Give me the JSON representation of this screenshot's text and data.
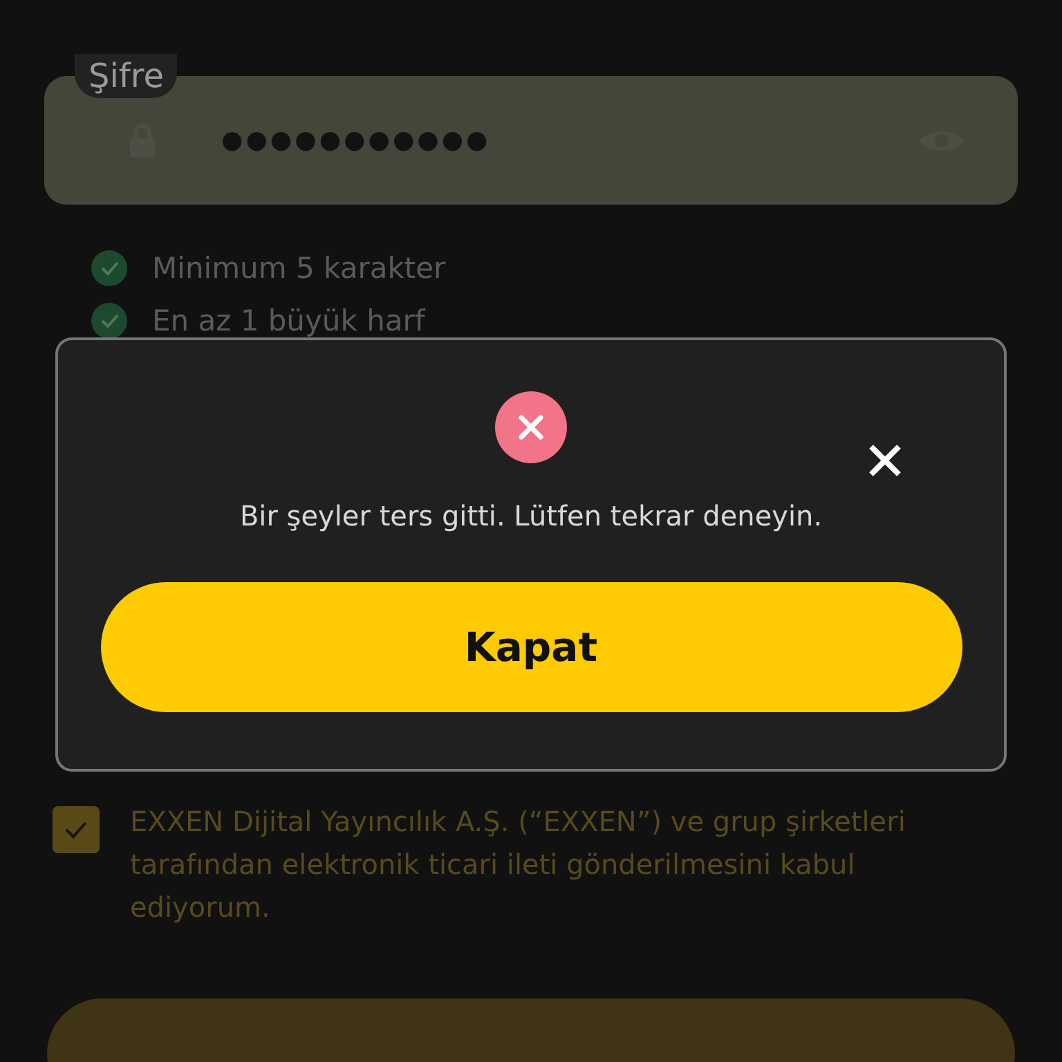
{
  "password_field": {
    "label": "Şifre",
    "value": "●●●●●●●●●●●"
  },
  "rules": [
    {
      "text": "Minimum 5 karakter",
      "met": true
    },
    {
      "text": "En az 1 büyük harf",
      "met": true
    }
  ],
  "consent": {
    "text": "EXXEN Dijital Yayıncılık A.Ş. (“EXXEN”) ve grup şirketleri tarafından elektronik ticari ileti gönderilmesini kabul ediyorum.",
    "checked": true
  },
  "dialog": {
    "kind": "error",
    "message": "Bir şeyler ters gitti. Lütfen tekrar deneyin.",
    "button": "Kapat"
  }
}
